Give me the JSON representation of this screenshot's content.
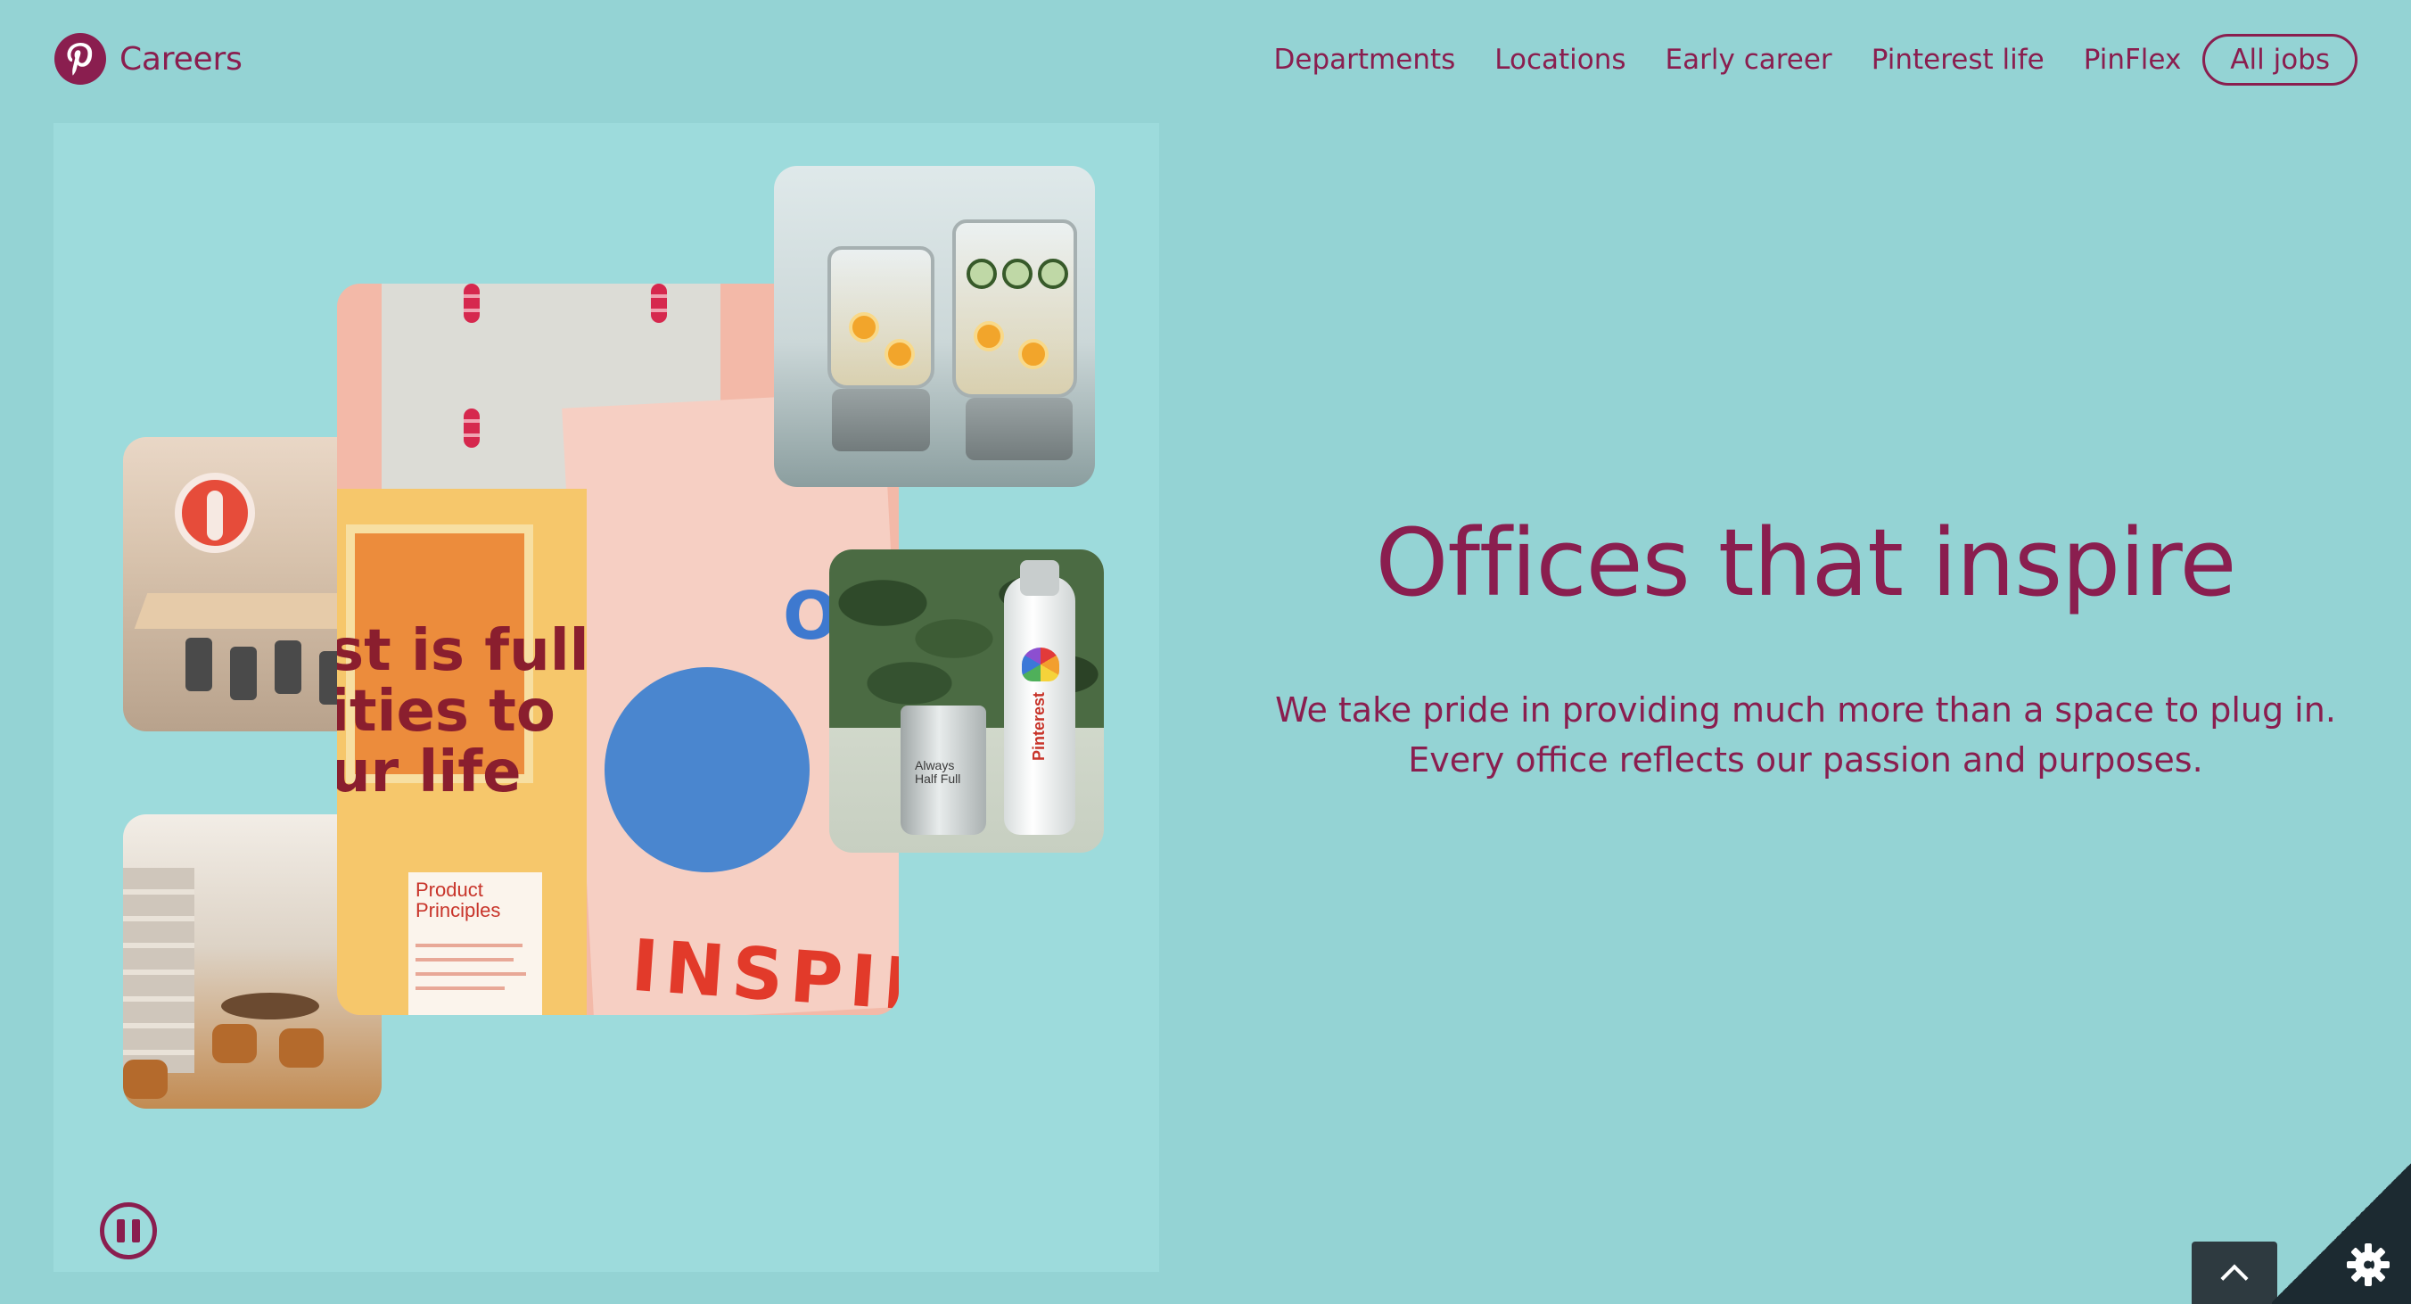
{
  "header": {
    "brand_label": "Careers",
    "logo_icon": "pinterest-logo-icon",
    "nav": [
      {
        "label": "Departments"
      },
      {
        "label": "Locations"
      },
      {
        "label": "Early career"
      },
      {
        "label": "Pinterest life"
      },
      {
        "label": "PinFlex"
      }
    ],
    "all_jobs_label": "All jobs"
  },
  "hero": {
    "title": "Offices that inspire",
    "body": "We take pride in providing much more than a space to plug in. Every office reflects our passion and purposes."
  },
  "media": {
    "pause_icon": "pause-icon",
    "collage": {
      "word_top": "OME",
      "word_bottom": "INSPIR",
      "headline_fragment": "st is full\nities to\nur life",
      "card_title": "Product\nPrinciples"
    },
    "bottle": {
      "brand_text": "Pinterest",
      "cup_text": "Always\nHalf Full"
    }
  },
  "controls": {
    "back_to_top_icon": "chevron-up-icon",
    "settings_icon": "gear-icon"
  },
  "colors": {
    "background": "#94d3d4",
    "panel": "#9ddbdc",
    "brand": "#8a1e4f",
    "dark": "#1c2a31"
  }
}
